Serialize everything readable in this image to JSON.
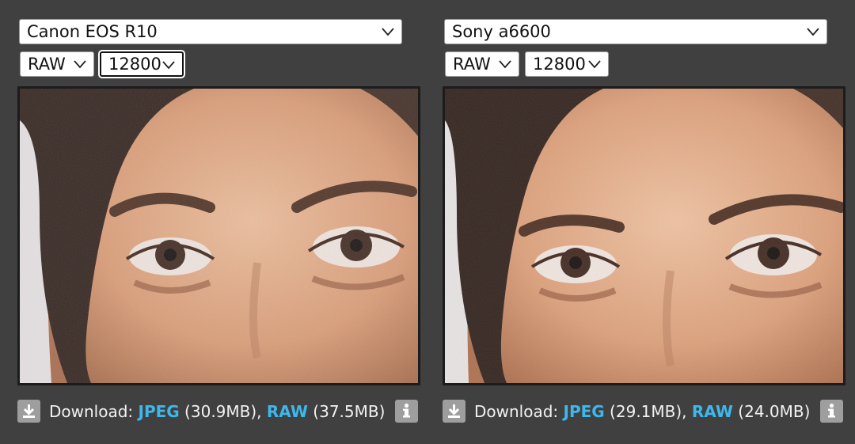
{
  "left": {
    "camera": "Canon EOS R10",
    "format": "RAW",
    "iso": "12800",
    "download": {
      "prefix": "Download: ",
      "jpeg_label": "JPEG",
      "jpeg_size": " (30.9MB), ",
      "raw_label": "RAW",
      "raw_size": " (37.5MB)"
    }
  },
  "right": {
    "camera": "Sony a6600",
    "format": "RAW",
    "iso": "12800",
    "download": {
      "prefix": "Download: ",
      "jpeg_label": "JPEG",
      "jpeg_size": " (29.1MB), ",
      "raw_label": "RAW",
      "raw_size": " (24.0MB)"
    }
  },
  "icons": {
    "download": "download-icon",
    "info": "info-icon",
    "dropdown": "chevron-down-icon"
  },
  "colors": {
    "background": "#404040",
    "link": "#3db8ec",
    "icon_bg": "#9e9e9e"
  }
}
